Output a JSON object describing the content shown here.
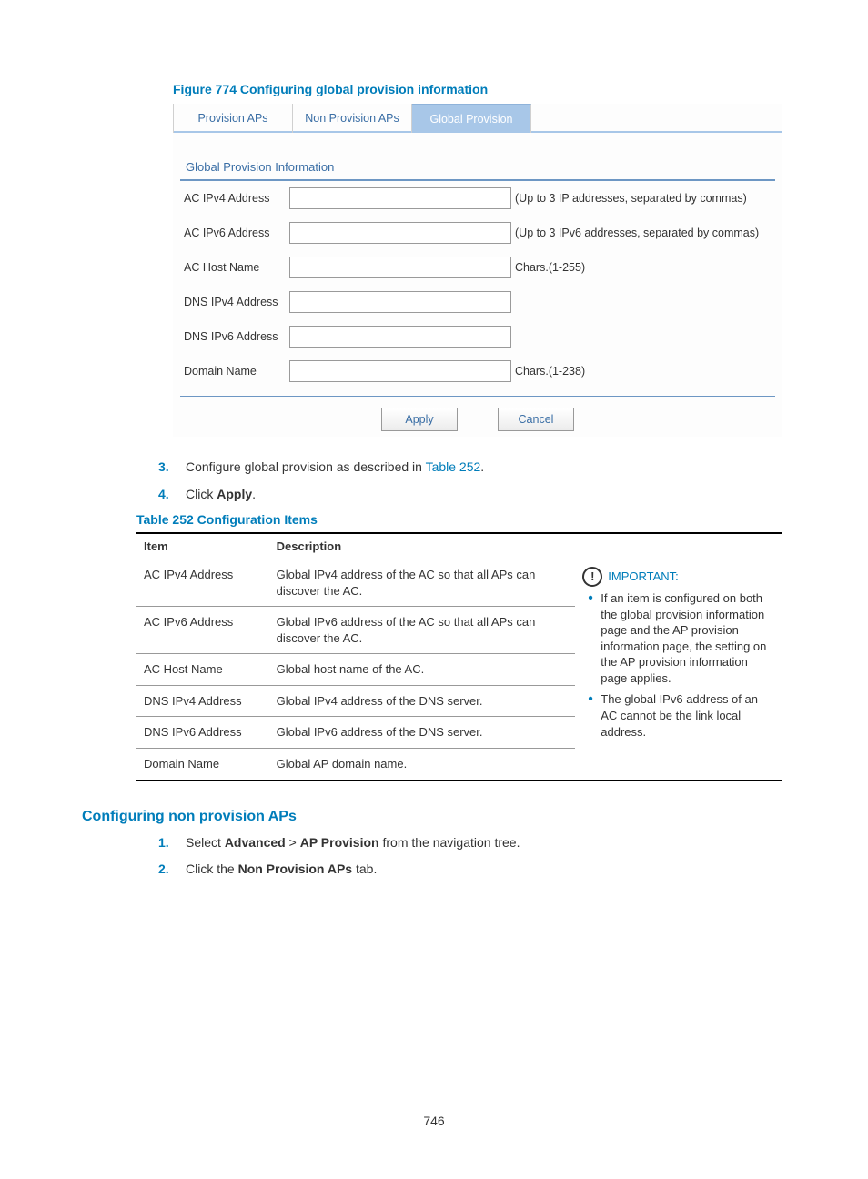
{
  "figure": {
    "caption": "Figure 774 Configuring global provision information",
    "tabs": [
      "Provision APs",
      "Non Provision APs",
      "Global Provision"
    ],
    "active_tab_index": 2,
    "panel_title": "Global Provision Information",
    "fields": [
      {
        "label": "AC IPv4 Address",
        "hint": "(Up to 3 IP addresses, separated by commas)"
      },
      {
        "label": "AC IPv6 Address",
        "hint": "(Up to 3 IPv6 addresses, separated by commas)"
      },
      {
        "label": "AC Host Name",
        "hint": "Chars.(1-255)"
      },
      {
        "label": "DNS IPv4 Address",
        "hint": ""
      },
      {
        "label": "DNS IPv6 Address",
        "hint": ""
      },
      {
        "label": "Domain Name",
        "hint": "Chars.(1-238)"
      }
    ],
    "apply": "Apply",
    "cancel": "Cancel"
  },
  "steps1": {
    "3": {
      "num": "3.",
      "pre": "Configure global provision as described in ",
      "link": "Table 252",
      "post": "."
    },
    "4": {
      "num": "4.",
      "pre": "Click ",
      "bold": "Apply",
      "post": "."
    }
  },
  "table": {
    "caption": "Table 252 Configuration Items",
    "head_item": "Item",
    "head_desc": "Description",
    "rows": [
      {
        "item": "AC IPv4 Address",
        "desc": "Global IPv4 address of the AC so that all APs can discover the AC."
      },
      {
        "item": "AC IPv6 Address",
        "desc": "Global IPv6 address of the AC so that all APs can discover the AC."
      },
      {
        "item": "AC Host Name",
        "desc": "Global host name of the AC."
      },
      {
        "item": "DNS IPv4 Address",
        "desc": "Global IPv4 address of the DNS server."
      },
      {
        "item": "DNS IPv6 Address",
        "desc": "Global IPv6 address of the DNS server."
      },
      {
        "item": "Domain Name",
        "desc": "Global AP domain name."
      }
    ],
    "important_label": "IMPORTANT:",
    "important": [
      "If an item is configured on both the global provision information page and the AP provision information page, the setting on the AP provision information page applies.",
      "The global IPv6 address of an AC cannot be the link local address."
    ]
  },
  "section2": {
    "heading": "Configuring non provision APs",
    "s1": {
      "num": "1.",
      "a": "Select ",
      "b": "Advanced",
      "c": " > ",
      "d": "AP Provision",
      "e": " from the navigation tree."
    },
    "s2": {
      "num": "2.",
      "a": "Click the ",
      "b": "Non Provision APs",
      "c": " tab."
    }
  },
  "page_number": "746"
}
